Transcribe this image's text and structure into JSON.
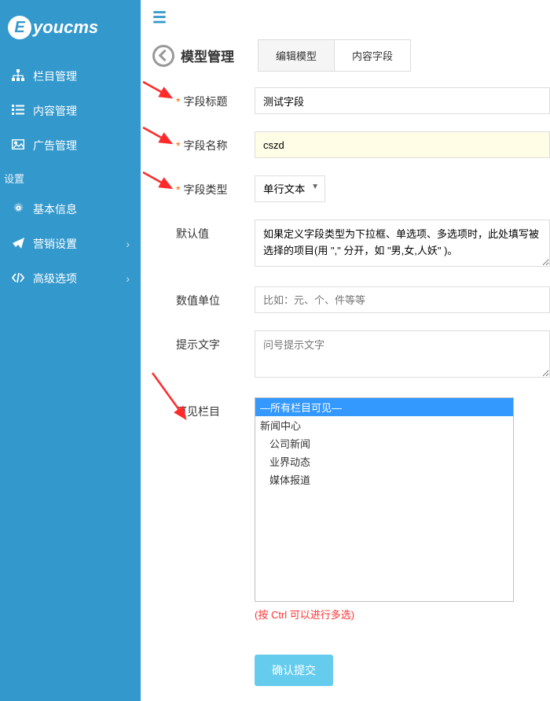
{
  "logo": {
    "text": "youcms",
    "icon_letter": "E"
  },
  "sidebar": {
    "items": [
      {
        "label": "栏目管理"
      },
      {
        "label": "内容管理"
      },
      {
        "label": "广告管理"
      }
    ],
    "section": "设置",
    "settings": [
      {
        "label": "基本信息"
      },
      {
        "label": "营销设置"
      },
      {
        "label": "高级选项"
      }
    ]
  },
  "header": {
    "title": "模型管理",
    "tabs": [
      {
        "label": "编辑模型",
        "active": false
      },
      {
        "label": "内容字段",
        "active": true
      }
    ]
  },
  "form": {
    "field_title": {
      "label": "字段标题",
      "value": "测试字段"
    },
    "field_name": {
      "label": "字段名称",
      "value": "cszd"
    },
    "field_type": {
      "label": "字段类型",
      "value": "单行文本"
    },
    "default_value": {
      "label": "默认值",
      "value": "如果定义字段类型为下拉框、单选项、多选项时，此处填写被选择的项目(用 \",\" 分开，如 \"男,女,人妖\" )。"
    },
    "unit": {
      "label": "数值单位",
      "placeholder": "比如：元、个、件等等"
    },
    "tip": {
      "label": "提示文字",
      "placeholder": "问号提示文字"
    },
    "visible_col": {
      "label": "可见栏目",
      "options": [
        {
          "label": "—所有栏目可见—",
          "selected": true,
          "indent": 0
        },
        {
          "label": "新闻中心",
          "indent": 0
        },
        {
          "label": "公司新闻",
          "indent": 1
        },
        {
          "label": "业界动态",
          "indent": 1
        },
        {
          "label": "媒体报道",
          "indent": 1
        }
      ],
      "hint": "(按 Ctrl 可以进行多选)"
    },
    "submit": "确认提交"
  }
}
